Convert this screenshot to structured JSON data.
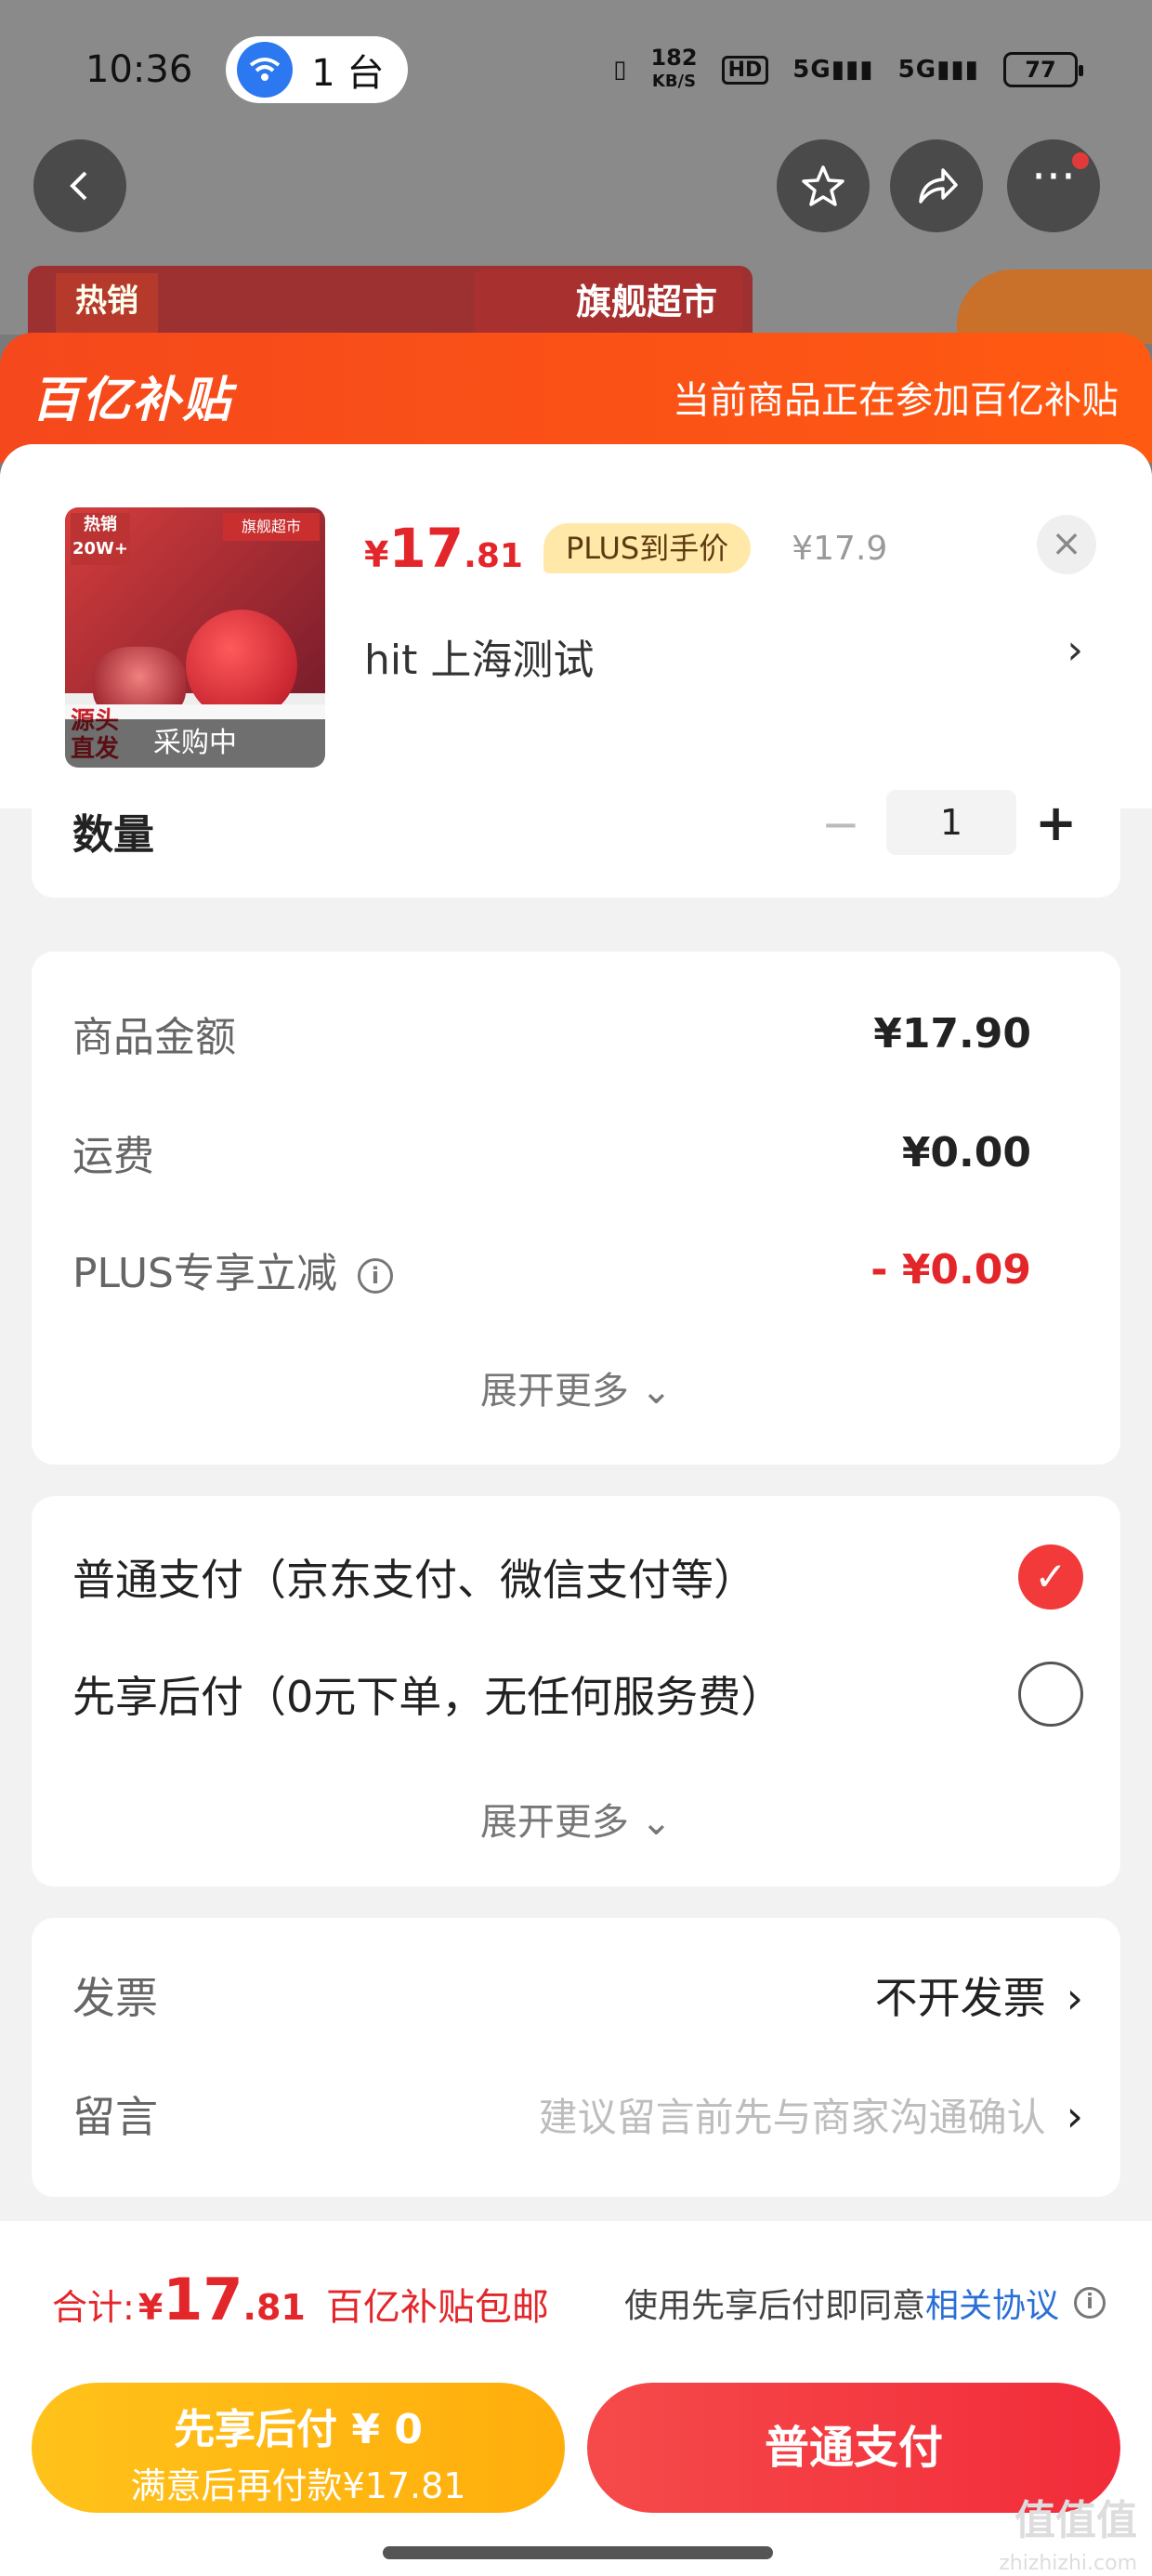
{
  "status_bar": {
    "time": "10:36",
    "hotspot_count": "1 台",
    "net_speed_value": "182",
    "net_speed_unit": "KB/S",
    "hd_label": "HD",
    "signal1": "5G",
    "signal2": "5G",
    "battery": "77"
  },
  "background": {
    "hot_tag": "热销",
    "flag_store": "旗舰超市"
  },
  "sheet_header": {
    "brand": "百亿补贴",
    "subtitle": "当前商品正在参加百亿补贴"
  },
  "product": {
    "thumb_hot_tag": "热销 20W+",
    "thumb_flag": "旗舰超市",
    "thumb_label_1": "源头",
    "thumb_label_2": "直发",
    "thumb_status": "采购中",
    "currency": "¥",
    "price_int": "17",
    "price_dec": ".81",
    "plus_tag": "PLUS到手价",
    "old_price": "¥17.9",
    "address": "hit  上海测试",
    "close_icon": "×",
    "address_arrow": "›"
  },
  "quantity": {
    "label": "数量",
    "minus": "−",
    "value": "1",
    "plus": "+"
  },
  "price_details": {
    "goods_label": "商品金额",
    "goods_value": "¥17.90",
    "shipping_label": "运费",
    "shipping_value": "¥0.00",
    "plus_label": "PLUS专享立减",
    "plus_value": "- ¥0.09",
    "expand": "展开更多 ⌄"
  },
  "payment": {
    "option1": "普通支付（京东支付、微信支付等）",
    "option2": "先享后付（0元下单，无任何服务费）",
    "option1_selected": true,
    "expand": "展开更多 ⌄"
  },
  "extra": {
    "invoice_label": "发票",
    "invoice_value": "不开发票",
    "note_label": "留言",
    "note_placeholder": "建议留言前先与商家沟通确认"
  },
  "footer": {
    "total_label": "合计:",
    "total_currency": "¥",
    "total_int": "17",
    "total_dec": ".81",
    "total_note": "百亿补贴包邮",
    "agree_text": "使用先享后付即同意",
    "agree_link": "相关协议",
    "btn_later_line1": "先享后付 ¥ 0",
    "btn_later_line2": "满意后再付款¥17.81",
    "btn_pay": "普通支付",
    "watermark": "值值值",
    "watermark_sub": "zhizhizhi.com"
  },
  "colors": {
    "accent_red": "#e3262a",
    "header_orange": "#f5481c",
    "later_button": "#ffb814",
    "pay_button": "#f23a3a",
    "link_blue": "#2a6fd6"
  }
}
